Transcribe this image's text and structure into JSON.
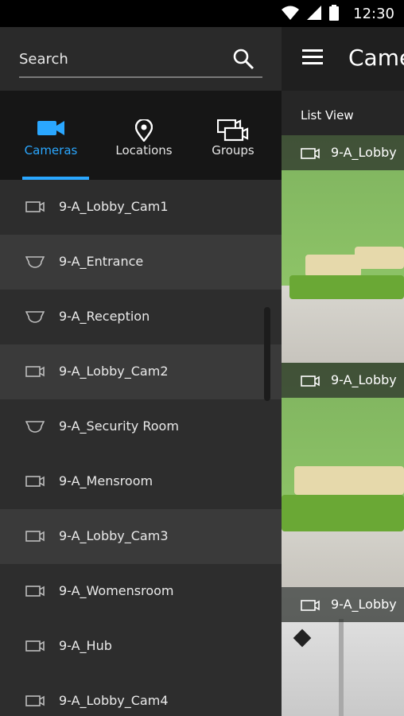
{
  "status_bar": {
    "time": "12:30"
  },
  "drawer": {
    "search": {
      "label": "Search"
    },
    "tabs": [
      {
        "label": "Cameras",
        "icon": "camera-icon",
        "active": true
      },
      {
        "label": "Locations",
        "icon": "location-pin-icon",
        "active": false
      },
      {
        "label": "Groups",
        "icon": "groups-icon",
        "active": false
      }
    ],
    "cameras": [
      {
        "name": "9-A_Lobby_Cam1",
        "icon": "box-camera-icon"
      },
      {
        "name": "9-A_Entrance",
        "icon": "dome-camera-icon"
      },
      {
        "name": "9-A_Reception",
        "icon": "dome-camera-icon"
      },
      {
        "name": "9-A_Lobby_Cam2",
        "icon": "box-camera-icon"
      },
      {
        "name": "9-A_Security Room",
        "icon": "dome-camera-icon"
      },
      {
        "name": "9-A_Mensroom",
        "icon": "box-camera-icon"
      },
      {
        "name": "9-A_Lobby_Cam3",
        "icon": "box-camera-icon"
      },
      {
        "name": "9-A_Womensroom",
        "icon": "box-camera-icon"
      },
      {
        "name": "9-A_Hub",
        "icon": "box-camera-icon"
      },
      {
        "name": "9-A_Lobby_Cam4",
        "icon": "box-camera-icon"
      }
    ]
  },
  "main": {
    "title": "Came",
    "view_tab": "List View",
    "feeds": [
      {
        "label": "9-A_Lobby"
      },
      {
        "label": "9-A_Lobby"
      },
      {
        "label": "9-A_Lobby"
      }
    ]
  },
  "colors": {
    "accent": "#2aa7ff",
    "drawer_bg": "#2d2d2d",
    "row_alt": "#3a3a3a"
  }
}
